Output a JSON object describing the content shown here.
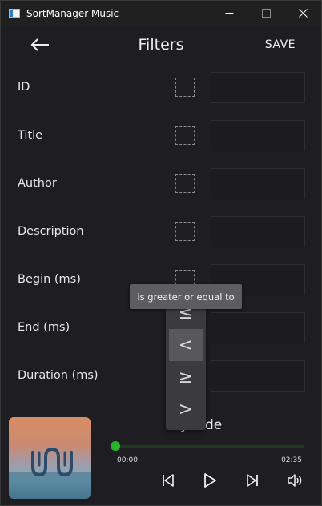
{
  "window": {
    "title": "SortManager Music",
    "minimize_icon": "minimize-icon",
    "maximize_icon": "maximize-icon",
    "close_icon": "close-icon"
  },
  "appbar": {
    "back_icon": "arrow-left-icon",
    "title": "Filters",
    "save_label": "SAVE"
  },
  "filters": [
    {
      "label": "ID"
    },
    {
      "label": "Title"
    },
    {
      "label": "Author"
    },
    {
      "label": "Description"
    },
    {
      "label": "Begin (ms)"
    },
    {
      "label": "End (ms)"
    },
    {
      "label": "Duration (ms)"
    }
  ],
  "operator_menu": {
    "items": [
      "≤",
      "<",
      "≥",
      ">"
    ],
    "selected_index": 1,
    "tooltip": "is greater or equal to"
  },
  "player": {
    "track_title": "y Side",
    "time_start": "00:00",
    "time_end": "02:35",
    "progress": 0.0,
    "colors": {
      "accent": "#3fbf3f",
      "track": "#1f3a1f"
    }
  }
}
